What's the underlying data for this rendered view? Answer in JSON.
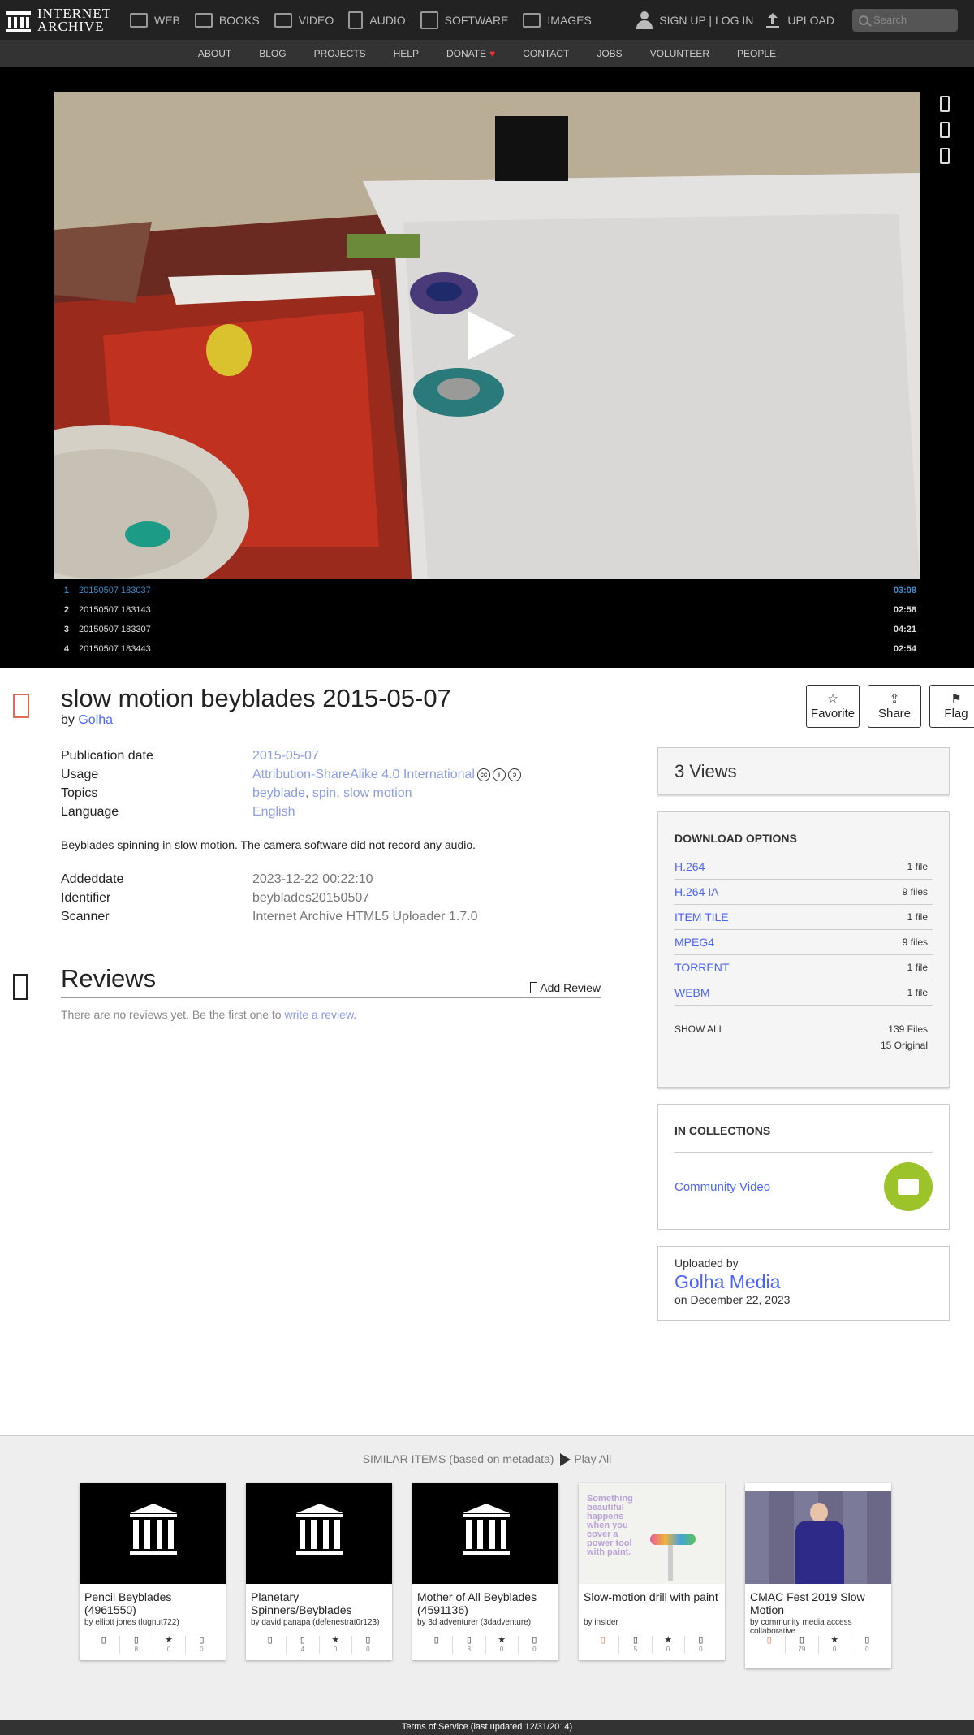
{
  "header": {
    "logo_line1": "INTERNET",
    "logo_line2": "ARCHIVE",
    "media": [
      {
        "label": "WEB",
        "icon": "web-icon"
      },
      {
        "label": "BOOKS",
        "icon": "books-icon"
      },
      {
        "label": "VIDEO",
        "icon": "video-icon"
      },
      {
        "label": "AUDIO",
        "icon": "audio-icon"
      },
      {
        "label": "SOFTWARE",
        "icon": "software-icon"
      },
      {
        "label": "IMAGES",
        "icon": "images-icon"
      }
    ],
    "signup": "SIGN UP | LOG IN",
    "upload": "UPLOAD",
    "search_placeholder": "Search"
  },
  "subnav": [
    "ABOUT",
    "BLOG",
    "PROJECTS",
    "HELP",
    "DONATE",
    "CONTACT",
    "JOBS",
    "VOLUNTEER",
    "PEOPLE"
  ],
  "playlist": [
    {
      "num": "1",
      "title": "20150507 183037",
      "duration": "03:08"
    },
    {
      "num": "2",
      "title": "20150507 183143",
      "duration": "02:58"
    },
    {
      "num": "3",
      "title": "20150507 183307",
      "duration": "04:21"
    },
    {
      "num": "4",
      "title": "20150507 183443",
      "duration": "02:54"
    }
  ],
  "item": {
    "title": "slow motion beyblades 2015-05-07",
    "by_prefix": "by",
    "creator": "Golha",
    "actions": {
      "favorite": "Favorite",
      "share": "Share",
      "flag": "Flag"
    },
    "meta": {
      "pubdate_key": "Publication date",
      "pubdate_val": "2015-05-07",
      "usage_key": "Usage",
      "usage_val": "Attribution-ShareAlike 4.0 International",
      "topics_key": "Topics",
      "topic1": "beyblade",
      "sep1": ", ",
      "topic2": "spin",
      "sep2": ", ",
      "topic3": "slow motion",
      "lang_key": "Language",
      "lang_val": "English"
    },
    "description": "Beyblades spinning in slow motion. The camera software did not record any audio.",
    "meta2": {
      "added_key": "Addeddate",
      "added_val": "2023-12-22 00:22:10",
      "id_key": "Identifier",
      "id_val": "beyblades20150507",
      "scanner_key": "Scanner",
      "scanner_val": "Internet Archive HTML5 Uploader 1.7.0"
    }
  },
  "reviews": {
    "title": "Reviews",
    "add": "Add Review",
    "empty_text": "There are no reviews yet. Be the first one to ",
    "write_link": "write a review",
    "period": "."
  },
  "sidebar": {
    "views": "3 Views",
    "download_title": "DOWNLOAD OPTIONS",
    "downloads": [
      {
        "format": "H.264",
        "count": "1 file"
      },
      {
        "format": "H.264 IA",
        "count": "9 files"
      },
      {
        "format": "ITEM TILE",
        "count": "1 file"
      },
      {
        "format": "MPEG4",
        "count": "9 files"
      },
      {
        "format": "TORRENT",
        "count": "1 file"
      },
      {
        "format": "WEBM",
        "count": "1 file"
      }
    ],
    "show_all": "SHOW ALL",
    "total_files": "139 Files",
    "original": "15 Original",
    "collections_title": "IN COLLECTIONS",
    "collection_name": "Community Video",
    "uploaded_by_label": "Uploaded by",
    "uploader": "Golha Media",
    "uploaded_date": "on December 22, 2023"
  },
  "similar": {
    "heading": "SIMILAR ITEMS (based on metadata)",
    "play_all": "Play All",
    "items": [
      {
        "title": "Pencil Beyblades (4961550)",
        "by": "by elliott jones (lugnut722)",
        "views": "8",
        "favs": "0",
        "reviews": "0"
      },
      {
        "title": "Planetary Spinners/Beyblades",
        "by": "by david panapa (defenestrat0r123)",
        "views": "4",
        "favs": "0",
        "reviews": "0"
      },
      {
        "title": "Mother of All Beyblades (4591136)",
        "by": "by 3d adventurer (3dadventure)",
        "views": "8",
        "favs": "0",
        "reviews": "0"
      },
      {
        "title": "Slow-motion drill with paint",
        "by": "by insider",
        "views": "5",
        "favs": "0",
        "reviews": "0"
      },
      {
        "title": "CMAC Fest 2019 Slow Motion",
        "by": "by community media access collaborative",
        "views": "79",
        "favs": "0",
        "reviews": "0"
      }
    ],
    "drill_text": "Something beautiful happens when you cover a power tool with paint."
  },
  "footer": "Terms of Service (last updated 12/31/2014)"
}
